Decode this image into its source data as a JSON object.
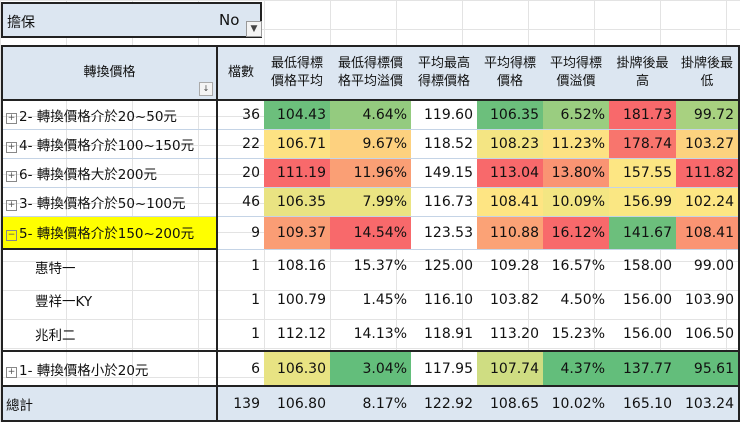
{
  "filter": {
    "label": "擔保",
    "value": "No",
    "icon": "filter-icon"
  },
  "headers": [
    "轉換價格",
    "檔數",
    "最低得標\n價格平均",
    "最低得標價\n格平均溢價",
    "平均最高\n得標價格",
    "平均得標\n價格",
    "平均得標\n價溢價",
    "掛牌後最\n高",
    "掛牌後最\n低"
  ],
  "rows": [
    {
      "label": "2- 轉換價格介於20~50元",
      "type": "group",
      "count": "36",
      "values": [
        "104.43",
        "4.64%",
        "119.60",
        "106.35",
        "6.52%",
        "181.73",
        "99.72"
      ],
      "colors": [
        "#6cbf7c",
        "#94cb7f",
        "#ffffff",
        "#6cbf7c",
        "#9acd80",
        "#f8696b",
        "#a8d180"
      ]
    },
    {
      "label": "4- 轉換價格介於100~150元",
      "type": "group",
      "count": "22",
      "values": [
        "106.71",
        "9.67%",
        "118.52",
        "108.23",
        "11.23%",
        "178.74",
        "103.27"
      ],
      "colors": [
        "#fde283",
        "#fdd17f",
        "#ffffff",
        "#f4e583",
        "#fde283",
        "#f8756d",
        "#fcd27f"
      ]
    },
    {
      "label": "6- 轉換價格大於200元",
      "type": "group",
      "count": "20",
      "values": [
        "111.19",
        "11.96%",
        "149.15",
        "113.04",
        "13.80%",
        "157.55",
        "111.82"
      ],
      "colors": [
        "#f8696b",
        "#fa9f75",
        "#ffffff",
        "#f8696b",
        "#fa9473",
        "#fde683",
        "#f8696b"
      ]
    },
    {
      "label": "3- 轉換價格介於50~100元",
      "type": "group",
      "count": "46",
      "values": [
        "106.35",
        "7.99%",
        "116.73",
        "108.41",
        "10.09%",
        "156.99",
        "102.24"
      ],
      "colors": [
        "#e9e382",
        "#ebe482",
        "#ffffff",
        "#fee583",
        "#f3e683",
        "#fae783",
        "#fde683"
      ]
    },
    {
      "label": "5- 轉換價格介於150~200元",
      "type": "selected",
      "count": "9",
      "values": [
        "109.37",
        "14.54%",
        "123.53",
        "110.88",
        "16.12%",
        "141.67",
        "108.41"
      ],
      "colors": [
        "#fa9d75",
        "#f8696b",
        "#ffffff",
        "#fba276",
        "#f8696b",
        "#6cbf7c",
        "#fa9473"
      ]
    },
    {
      "label": "惠特一",
      "type": "child",
      "count": "1",
      "values": [
        "108.16",
        "15.37%",
        "125.00",
        "109.28",
        "16.57%",
        "158.00",
        "99.00"
      ],
      "colors": []
    },
    {
      "label": "豐祥一KY",
      "type": "child",
      "count": "1",
      "values": [
        "100.79",
        "1.45%",
        "116.10",
        "103.82",
        "4.50%",
        "156.00",
        "103.90"
      ],
      "colors": []
    },
    {
      "label": "兆利二",
      "type": "child",
      "count": "1",
      "values": [
        "112.12",
        "14.13%",
        "118.91",
        "113.20",
        "15.23%",
        "156.00",
        "106.50"
      ],
      "colors": []
    },
    {
      "label": "1- 轉換價格小於20元",
      "type": "group",
      "count": "6",
      "values": [
        "106.30",
        "3.04%",
        "117.95",
        "107.74",
        "4.37%",
        "137.77",
        "95.61"
      ],
      "colors": [
        "#e8e383",
        "#63be7b",
        "#ffffff",
        "#cfdd82",
        "#63be7b",
        "#63be7b",
        "#63be7b"
      ]
    },
    {
      "label": "總計",
      "type": "total",
      "count": "139",
      "values": [
        "106.80",
        "8.17%",
        "122.92",
        "108.65",
        "10.02%",
        "165.10",
        "103.24"
      ],
      "colors": []
    }
  ]
}
